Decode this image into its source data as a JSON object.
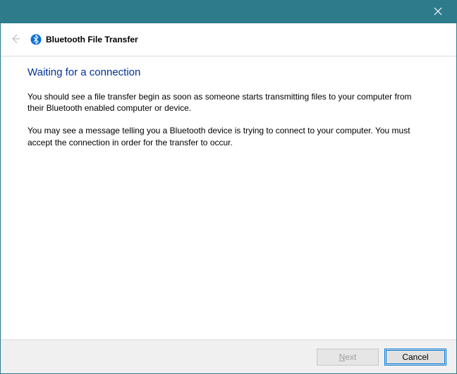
{
  "titlebar": {
    "close_tooltip": "Close"
  },
  "header": {
    "back_label": "Back",
    "icon_name": "bluetooth-icon",
    "title": "Bluetooth File Transfer"
  },
  "content": {
    "heading": "Waiting for a connection",
    "paragraph1": "You should see a file transfer begin as soon as someone starts transmitting files to your computer from their Bluetooth enabled computer or device.",
    "paragraph2": "You may see a message telling you a Bluetooth device is trying to connect to your computer. You must accept the connection in order for the transfer to occur."
  },
  "footer": {
    "next_mnemonic": "N",
    "next_rest": "ext",
    "cancel_label": "Cancel",
    "next_enabled": false
  }
}
